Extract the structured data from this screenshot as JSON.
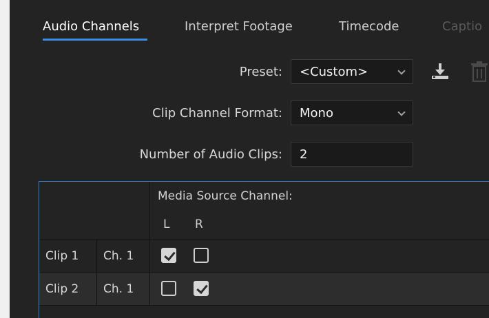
{
  "tabs": [
    {
      "label": "Audio Channels",
      "active": true
    },
    {
      "label": "Interpret Footage",
      "active": false
    },
    {
      "label": "Timecode",
      "active": false
    },
    {
      "label": "Captio",
      "active": false
    }
  ],
  "form": {
    "preset_label": "Preset:",
    "preset_value": "<Custom>",
    "clip_channel_format_label": "Clip Channel Format:",
    "clip_channel_format_value": "Mono",
    "number_of_audio_clips_label": "Number of Audio Clips:",
    "number_of_audio_clips_value": "2"
  },
  "table": {
    "header": "Media Source Channel:",
    "channels": [
      "L",
      "R"
    ],
    "rows": [
      {
        "clip": "Clip 1",
        "channel": "Ch. 1",
        "L": true,
        "R": false
      },
      {
        "clip": "Clip 2",
        "channel": "Ch. 1",
        "L": false,
        "R": true
      }
    ]
  },
  "icons": {
    "save_preset": "download-icon",
    "delete_preset": "trash-icon"
  },
  "colors": {
    "accent": "#3b8ee6",
    "panel_bg": "#232323"
  }
}
